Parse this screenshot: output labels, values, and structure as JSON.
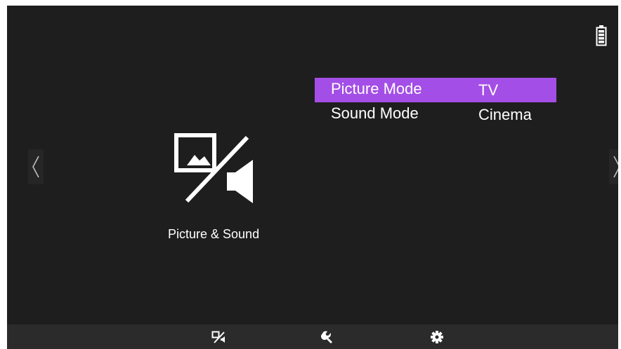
{
  "status": {
    "battery_icon": "battery-icon"
  },
  "navigation": {
    "prev_icon": "chevron-left-icon",
    "next_icon": "chevron-right-icon"
  },
  "category": {
    "icon": "picture-sound-icon",
    "label": "Picture & Sound"
  },
  "menu": {
    "items": [
      {
        "label": "Picture Mode",
        "value": "TV",
        "selected": true
      },
      {
        "label": "Sound Mode",
        "value": "Cinema",
        "selected": false
      }
    ]
  },
  "bottom_tabs": [
    {
      "icon": "picture-sound-icon"
    },
    {
      "icon": "wrench-icon"
    },
    {
      "icon": "gear-icon"
    }
  ],
  "colors": {
    "background": "#1e1e1e",
    "highlight": "#a34ee6",
    "bottom_bar": "#2b2b2b",
    "text": "#ffffff"
  }
}
